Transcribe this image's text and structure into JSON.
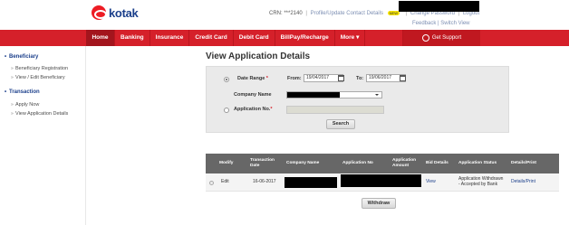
{
  "header": {
    "logo_text": "kotak",
    "crn": "CRN: ***2140",
    "profile_link": "Profile/Update Contact Details",
    "new_badge": "NEW",
    "change_password": "Change Password",
    "logout": "Logout",
    "feedback": "Feedback",
    "switch_view": "Switch View"
  },
  "nav": {
    "items": [
      "Home",
      "Banking",
      "Insurance",
      "Credit Card",
      "Debit Card",
      "BillPay/Recharge",
      "More"
    ],
    "active": "Home",
    "get_support": "Get Support",
    "brand_color": "#d5202a"
  },
  "sidebar": {
    "sections": [
      {
        "title": "Beneficiary",
        "items": [
          "Beneficiary Registration",
          "View / Edit Beneficiary"
        ]
      },
      {
        "title": "Transaction",
        "items": [
          "Apply Now",
          "View Application Details"
        ]
      }
    ]
  },
  "main": {
    "title": "View Application Details",
    "date_range_label": "Date Range",
    "from_label": "From:",
    "from_value": "19/04/2017",
    "to_label": "To:",
    "to_value": "19/06/2017",
    "company_name_label": "Company Name",
    "application_no_label": "Application No.",
    "search_button": "Search",
    "withdraw_button": "Withdraw"
  },
  "table": {
    "headers": [
      "Modify",
      "Transaction Date",
      "Company Name",
      "Application No",
      "Application Amount",
      "Bid Details",
      "Application Status",
      "Details/Print"
    ],
    "rows": [
      {
        "modify": "Edit",
        "date": "16-06-2017",
        "bid": "View",
        "status": "Application Withdrawn - Accepted by Bank",
        "details": "Details/Print"
      }
    ]
  }
}
